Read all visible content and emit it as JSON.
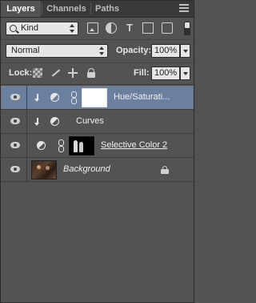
{
  "tabs": [
    "Layers",
    "Channels",
    "Paths"
  ],
  "filter": {
    "kind_label": "Kind"
  },
  "blend_mode": "Normal",
  "opacity": {
    "label": "Opacity:",
    "value": "100%"
  },
  "lock": {
    "label": "Lock:"
  },
  "fill": {
    "label": "Fill:",
    "value": "100%"
  },
  "layers": [
    {
      "name": "Hue/Saturati...",
      "selected": true
    },
    {
      "name": "Curves"
    },
    {
      "name": "Selective Color 2"
    },
    {
      "name": "Background"
    }
  ],
  "colors": {
    "panel_bg": "#535353",
    "selected_row": "#6b7f9f",
    "tab_bar": "#3a3a3a"
  }
}
